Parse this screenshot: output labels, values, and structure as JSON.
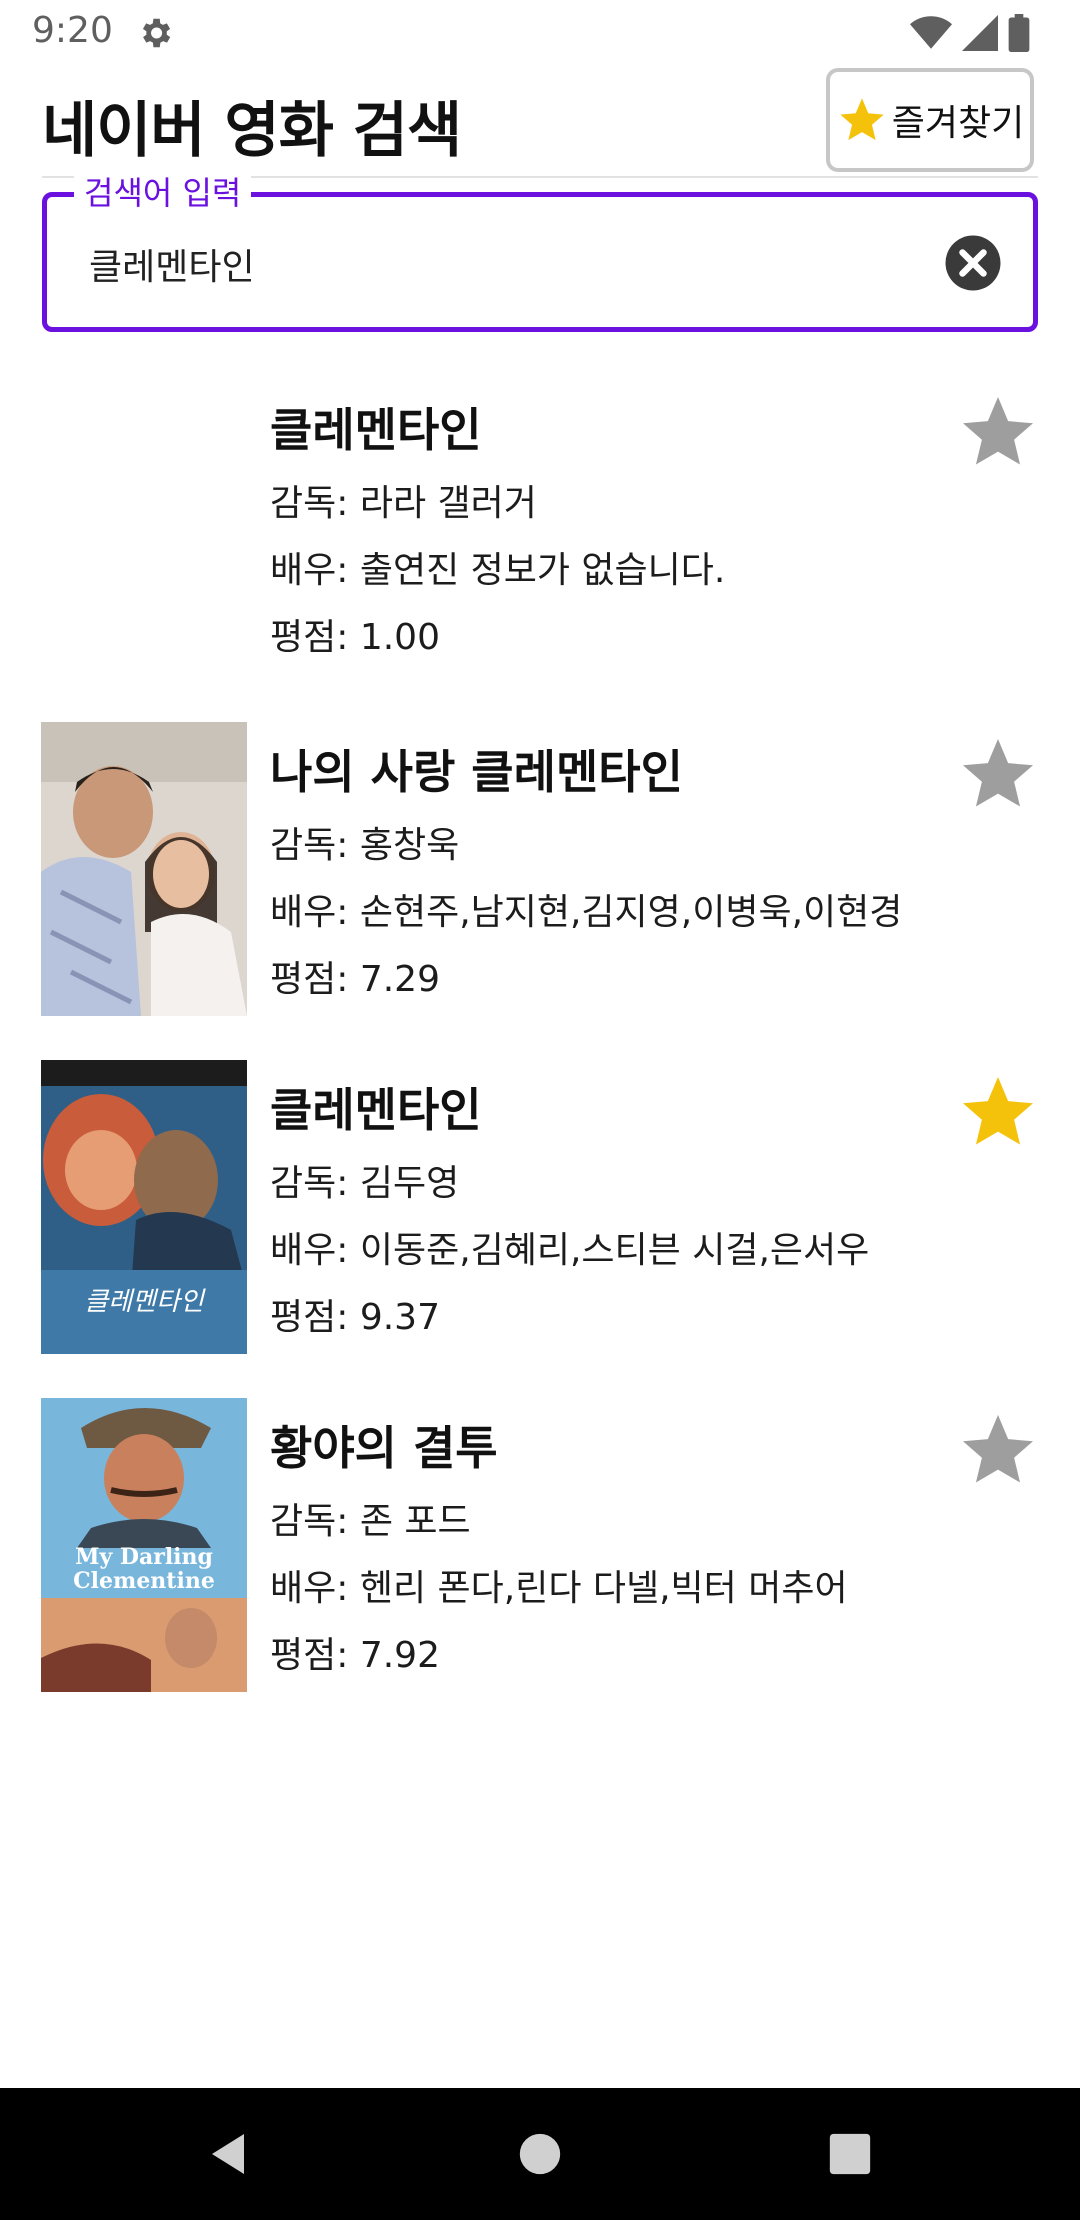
{
  "status_bar": {
    "time": "9:20"
  },
  "header": {
    "title": "네이버 영화 검색",
    "favorites_label": "즐겨찾기"
  },
  "search": {
    "label": "검색어 입력",
    "value": "클레멘타인"
  },
  "labels": {
    "director": "감독",
    "actors": "배우",
    "rating": "평점"
  },
  "movies": [
    {
      "title": "클레멘타인",
      "director": "라라 갤러거",
      "actors": "출연진 정보가 없습니다.",
      "rating": "1.00",
      "favorited": false,
      "has_poster": false
    },
    {
      "title": "나의 사랑 클레멘타인",
      "director": "홍창욱",
      "actors": "손현주,남지현,김지영,이병욱,이현경",
      "rating": "7.29",
      "favorited": false,
      "has_poster": true
    },
    {
      "title": "클레멘타인",
      "director": "김두영",
      "actors": "이동준,김혜리,스티븐 시걸,은서우",
      "rating": "9.37",
      "favorited": true,
      "has_poster": true,
      "poster_text": "클레멘타인"
    },
    {
      "title": "황야의 결투",
      "director": "존 포드",
      "actors": "헨리 폰다,린다 다넬,빅터 머추어",
      "rating": "7.92",
      "favorited": false,
      "has_poster": true,
      "poster_text": "My Darling Clementine"
    }
  ],
  "colors": {
    "accent": "#6a11e0",
    "star_on": "#f5c20b",
    "star_off": "#9e9e9e"
  },
  "icons": [
    "gear-icon",
    "wifi-icon",
    "signal-icon",
    "battery-icon",
    "star-icon",
    "clear-icon",
    "back-icon",
    "home-icon",
    "recents-icon"
  ]
}
